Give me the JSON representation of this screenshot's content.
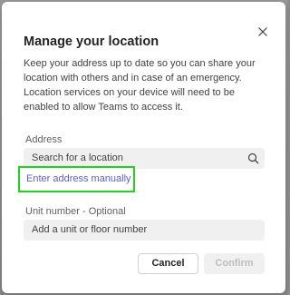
{
  "dialog": {
    "title": "Manage your location",
    "description": "Keep your address up to date so you can share your location with others and in case of an emergency. Location services on your device will need to be enabled to allow Teams to access it.",
    "close_icon": "close-icon"
  },
  "address": {
    "label": "Address",
    "placeholder": "Search for a location",
    "search_icon": "search-icon",
    "manual_link": "Enter address manually"
  },
  "unit": {
    "label": "Unit number - Optional",
    "placeholder": "Add a unit or floor number"
  },
  "buttons": {
    "cancel": "Cancel",
    "confirm": "Confirm"
  },
  "colors": {
    "link": "#5b5fc7",
    "highlight": "#22d11e",
    "field_bg": "#f0f0f0",
    "disabled_text": "#bdbdbd"
  }
}
